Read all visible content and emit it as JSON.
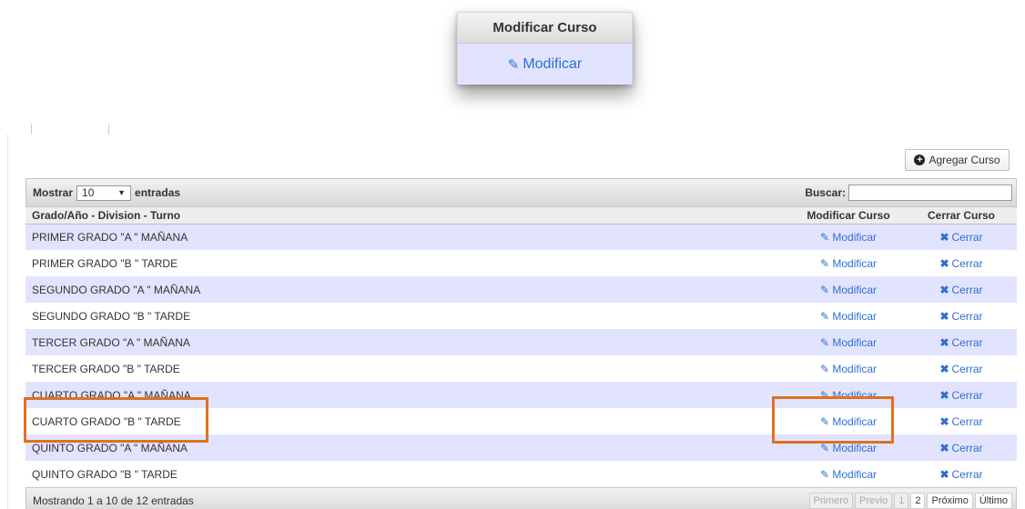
{
  "callout": {
    "header": "Modificar Curso",
    "action": "Modificar",
    "icon": "edit-icon"
  },
  "toolbar": {
    "add_button": "Agregar Curso",
    "show_label": "Mostrar",
    "page_size": "10",
    "entries_label": "entradas",
    "search_label": "Buscar:",
    "search_value": ""
  },
  "table": {
    "headers": [
      "Grado/Año - Division - Turno",
      "Modificar Curso",
      "Cerrar Curso"
    ],
    "rows": [
      {
        "curso": "PRIMER GRADO \"A \" MAÑANA",
        "modify": "Modificar",
        "close": "Cerrar"
      },
      {
        "curso": "PRIMER GRADO \"B \" TARDE",
        "modify": "Modificar",
        "close": "Cerrar"
      },
      {
        "curso": "SEGUNDO GRADO \"A \" MAÑANA",
        "modify": "Modificar",
        "close": "Cerrar"
      },
      {
        "curso": "SEGUNDO GRADO \"B \" TARDE",
        "modify": "Modificar",
        "close": "Cerrar"
      },
      {
        "curso": "TERCER GRADO \"A \" MAÑANA",
        "modify": "Modificar",
        "close": "Cerrar"
      },
      {
        "curso": "TERCER GRADO \"B \" TARDE",
        "modify": "Modificar",
        "close": "Cerrar"
      },
      {
        "curso": "CUARTO GRADO \"A \" MAÑANA",
        "modify": "Modificar",
        "close": "Cerrar"
      },
      {
        "curso": "CUARTO GRADO \"B \" TARDE",
        "modify": "Modificar",
        "close": "Cerrar"
      },
      {
        "curso": "QUINTO GRADO \"A \" MAÑANA",
        "modify": "Modificar",
        "close": "Cerrar"
      },
      {
        "curso": "QUINTO GRADO \"B \" TARDE",
        "modify": "Modificar",
        "close": "Cerrar"
      }
    ]
  },
  "footer": {
    "info": "Mostrando 1 a 10 de 12 entradas",
    "pager": [
      "Primero",
      "Previo",
      "1",
      "2",
      "Próximo",
      "Último"
    ]
  },
  "colors": {
    "link": "#2e6fd1",
    "row_alt": "#e2e4ff",
    "highlight": "#e07020"
  }
}
